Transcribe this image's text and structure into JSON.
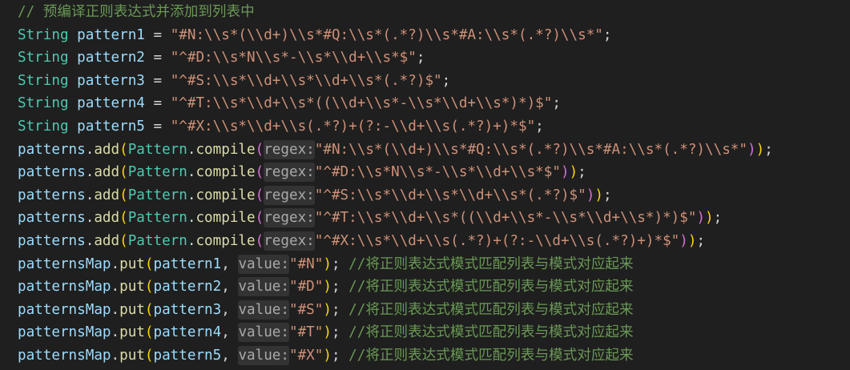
{
  "editor": {
    "comment_line": "// 预编译正则表达式并添加到列表中",
    "keyword_string": "String",
    "operators": {
      "assign": "=",
      "space": " ",
      "dot": ".",
      "semicolon": ";",
      "comma": ",",
      "open_paren": "(",
      "close_paren": ")"
    },
    "declarations": [
      {
        "name": "pattern1",
        "value": "\"#N:\\\\s*(\\\\d+)\\\\s*#Q:\\\\s*(.*?)\\\\s*#A:\\\\s*(.*?)\\\\s*\""
      },
      {
        "name": "pattern2",
        "value": "\"^#D:\\\\s*N\\\\s*-\\\\s*\\\\d+\\\\s*$\""
      },
      {
        "name": "pattern3",
        "value": "\"^#S:\\\\s*\\\\d+\\\\s*\\\\d+\\\\s*(.*?)$\""
      },
      {
        "name": "pattern4",
        "value": "\"^#T:\\\\s*\\\\d+\\\\s*((\\\\d+\\\\s*-\\\\s*\\\\d+\\\\s*)*)$\""
      },
      {
        "name": "pattern5",
        "value": "\"^#X:\\\\s*\\\\d+\\\\s(.*?)+(?:-\\\\d+\\\\s(.*?)+)*$\""
      }
    ],
    "add_calls": {
      "object": "patterns",
      "method": "add",
      "class_name": "Pattern",
      "class_method": "compile",
      "hint": "regex:",
      "args": [
        "\"#N:\\\\s*(\\\\d+)\\\\s*#Q:\\\\s*(.*?)\\\\s*#A:\\\\s*(.*?)\\\\s*\"",
        "\"^#D:\\\\s*N\\\\s*-\\\\s*\\\\d+\\\\s*$\"",
        "\"^#S:\\\\s*\\\\d+\\\\s*\\\\d+\\\\s*(.*?)$\"",
        "\"^#T:\\\\s*\\\\d+\\\\s*((\\\\d+\\\\s*-\\\\s*\\\\d+\\\\s*)*)$\"",
        "\"^#X:\\\\s*\\\\d+\\\\s(.*?)+(?:-\\\\d+\\\\s(.*?)+)*$\""
      ]
    },
    "put_calls": {
      "object": "patternsMap",
      "method": "put",
      "hint": "value:",
      "comment": "//将正则表达式模式匹配列表与模式对应起来",
      "items": [
        {
          "key": "pattern1",
          "value": "\"#N\""
        },
        {
          "key": "pattern2",
          "value": "\"#D\""
        },
        {
          "key": "pattern3",
          "value": "\"#S\""
        },
        {
          "key": "pattern4",
          "value": "\"#T\""
        },
        {
          "key": "pattern5",
          "value": "\"#X\""
        }
      ]
    }
  }
}
